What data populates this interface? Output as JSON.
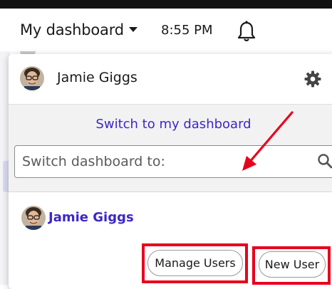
{
  "header": {
    "dashboard_title": "My dashboard",
    "time": "8:55 PM"
  },
  "panel": {
    "user_name": "Jamie Giggs",
    "switch_link": "Switch to my dashboard",
    "search_placeholder": "Switch dashboard to:",
    "dashboard_user": "Jamie Giggs",
    "manage_users_label": "Manage Users",
    "new_user_label": "New User"
  },
  "icons": {
    "caret": "chevron-down-icon",
    "notifications": "bell-icon",
    "settings": "gear-icon",
    "search": "search-icon"
  },
  "colors": {
    "link": "#3c28c8",
    "highlight": "#e8001c",
    "panel_gray": "#f2f2f2"
  }
}
